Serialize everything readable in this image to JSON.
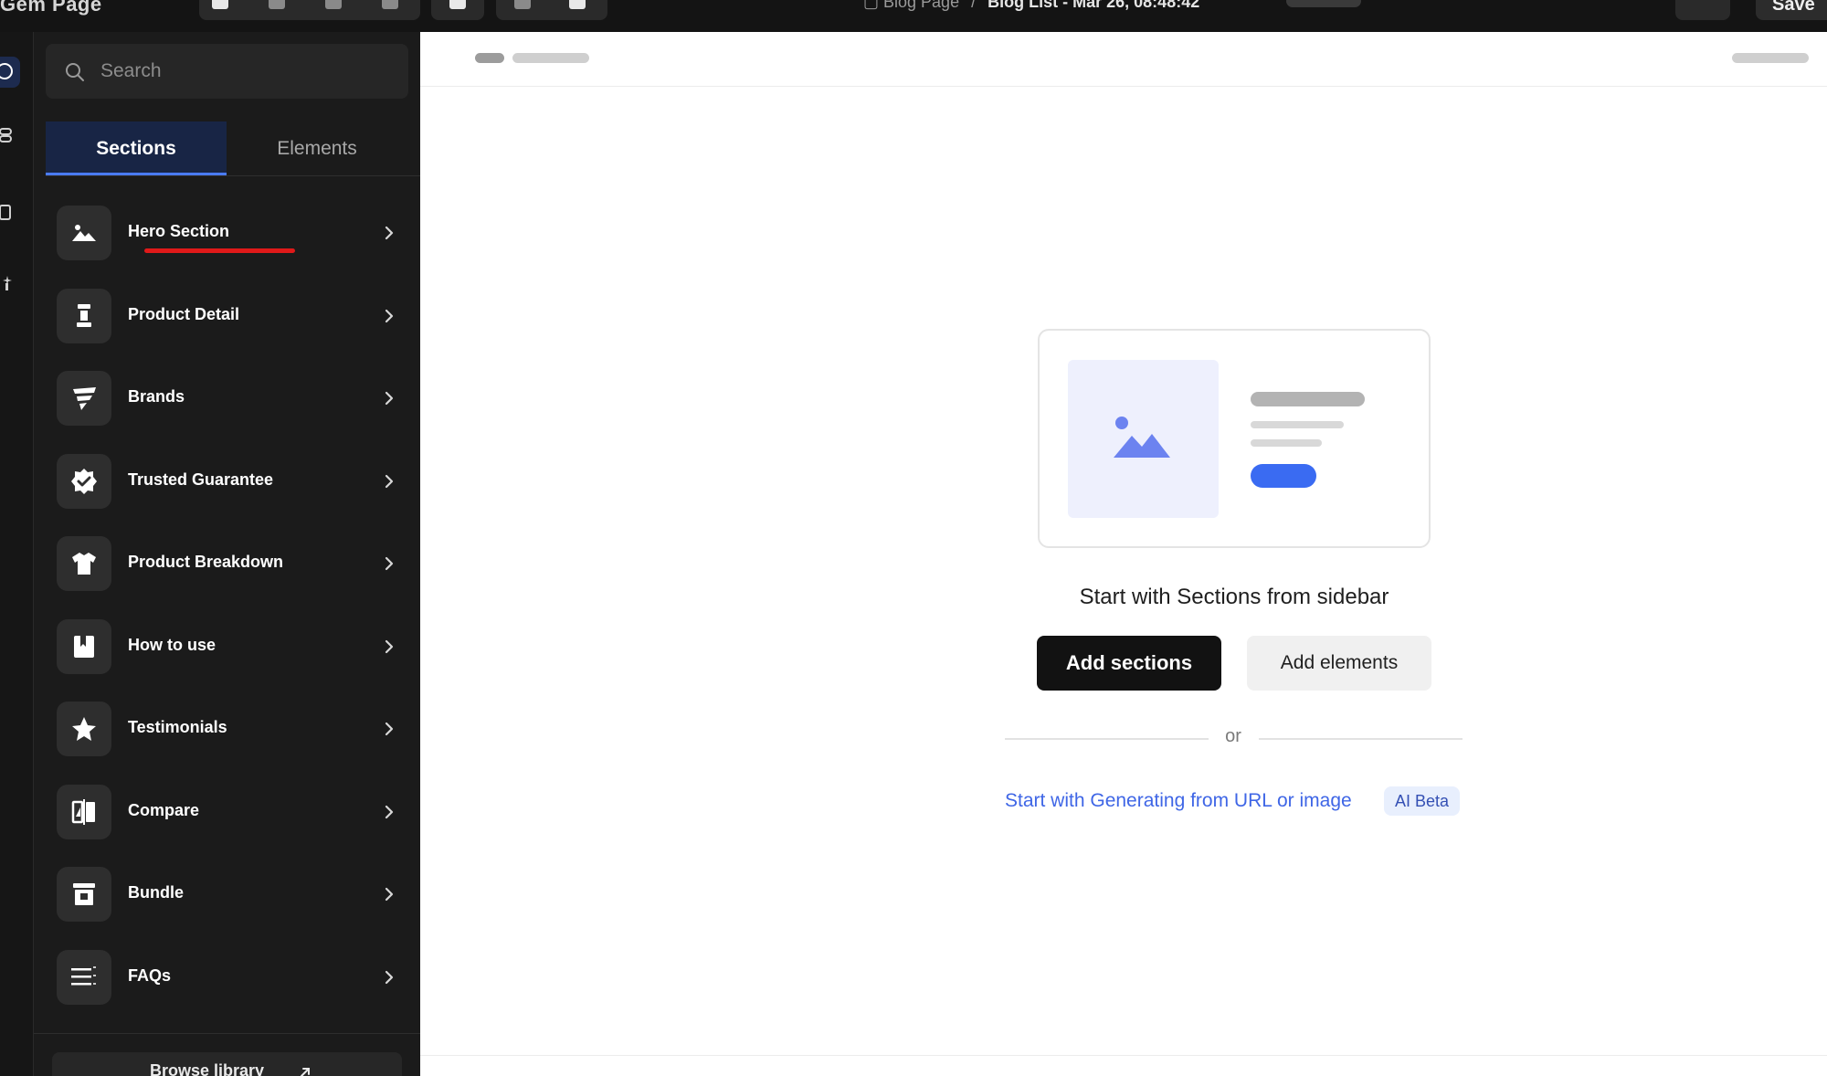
{
  "topbar": {
    "app_name": "Gem Page",
    "breadcrumb_parent": "Blog Page",
    "breadcrumb_separator": "/",
    "breadcrumb_current": "Blog List - Mar 26, 08:48:42",
    "save_label": "Save"
  },
  "search": {
    "placeholder": "Search"
  },
  "tabs": [
    {
      "label": "Sections",
      "active": true
    },
    {
      "label": "Elements",
      "active": false
    }
  ],
  "sections": [
    {
      "label": "Hero Section",
      "icon": "image-icon"
    },
    {
      "label": "Product Detail",
      "icon": "product-icon"
    },
    {
      "label": "Brands",
      "icon": "brands-icon"
    },
    {
      "label": "Trusted Guarantee",
      "icon": "badge-check-icon"
    },
    {
      "label": "Product Breakdown",
      "icon": "shirt-icon"
    },
    {
      "label": "How to use",
      "icon": "book-icon"
    },
    {
      "label": "Testimonials",
      "icon": "star-icon"
    },
    {
      "label": "Compare",
      "icon": "compare-icon"
    },
    {
      "label": "Bundle",
      "icon": "archive-icon"
    },
    {
      "label": "FAQs",
      "icon": "list-icon"
    }
  ],
  "browse_library": "Browse library",
  "empty_state": {
    "title": "Start with Sections from sidebar",
    "add_sections": "Add sections",
    "add_elements": "Add elements",
    "or": "or",
    "generate_link": "Start with Generating from URL or image",
    "ai_badge": "AI Beta"
  },
  "colors": {
    "accent": "#4a7bf7",
    "link": "#3f66e6",
    "highlight_underline": "#e01919",
    "sidebar_bg": "#1b1b1b"
  }
}
